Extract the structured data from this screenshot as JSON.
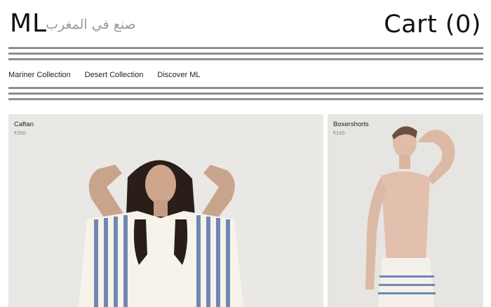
{
  "header": {
    "logo": "ML",
    "logo_arabic": "صنع في المغرب",
    "cart_label": "Cart (0)"
  },
  "nav": {
    "items": [
      {
        "label": "Mariner Collection"
      },
      {
        "label": "Desert Collection"
      },
      {
        "label": "Discover ML"
      }
    ]
  },
  "products": [
    {
      "name": "Caftan",
      "price": "€350"
    },
    {
      "name": "Boxershorts",
      "price": "€165"
    }
  ],
  "colors": {
    "stripe": "#8f8f8f",
    "photo_background": "#e9e8e4",
    "fabric_stripe": "#6f88b3"
  }
}
